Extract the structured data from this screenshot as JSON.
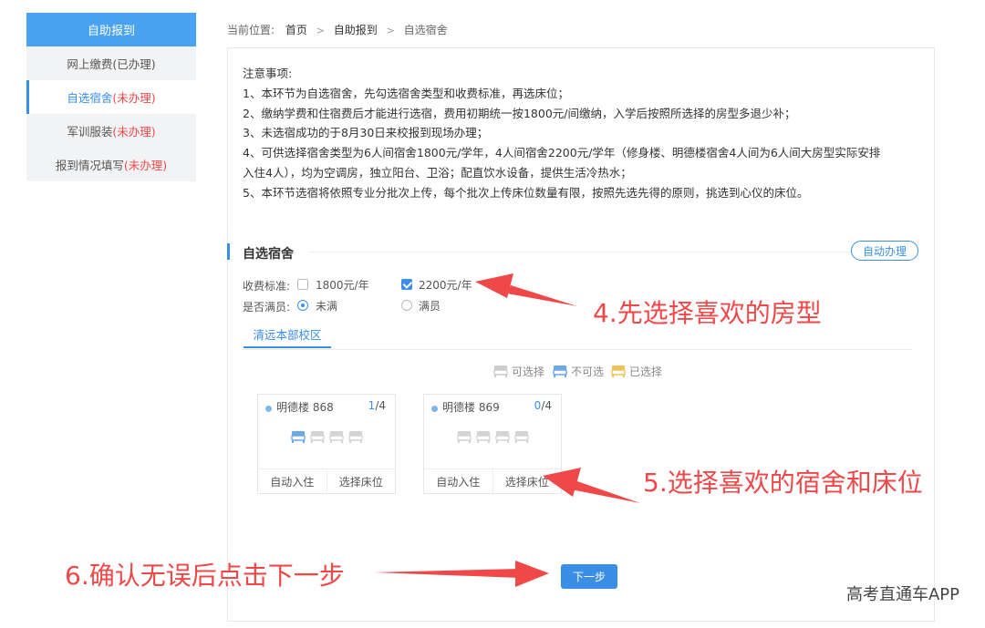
{
  "sidebar": {
    "header": "自助报到",
    "items": [
      {
        "label": "网上缴费",
        "status": "(已办理)"
      },
      {
        "label": "自选宿舍",
        "status": "(未办理)"
      },
      {
        "label": "军训服装",
        "status": "(未办理)"
      },
      {
        "label": "报到情况填写",
        "status": "(未办理)"
      }
    ]
  },
  "breadcrumb": {
    "prefix": "当前位置:",
    "items": [
      "首页",
      "自助报到",
      "自选宿舍"
    ],
    "separator": ">"
  },
  "notice": {
    "title": "注意事项:",
    "lines": [
      "1、本环节为自选宿舍，先勾选宿舍类型和收费标准，再选床位；",
      "2、缴纳学费和住宿费后才能进行选宿，费用初期统一按1800元/间缴纳，入学后按照所选择的房型多退少补；",
      "3、未选宿成功的于8月30日来校报到现场办理；",
      "4、可供选择宿舍类型为6人间宿舍1800元/学年，4人间宿舍2200元/学年（修身楼、明德楼宿舍4人间为6人间大房型实际安排",
      "入住4人），均为空调房，独立阳台、卫浴；配直饮水设备，提供生活冷热水；",
      "5、本环节选宿将依照专业分批次上传，每个批次上传床位数量有限，按照先选先得的原则，挑选到心仪的床位。"
    ]
  },
  "section": {
    "title": "自选宿舍",
    "auto_button": "自动办理"
  },
  "filters": {
    "fee_label": "收费标准:",
    "fee_options": [
      {
        "label": "1800元/年",
        "checked": false
      },
      {
        "label": "2200元/年",
        "checked": true
      }
    ],
    "full_label": "是否满员:",
    "full_options": [
      {
        "label": "未满",
        "checked": true
      },
      {
        "label": "满员",
        "checked": false
      }
    ]
  },
  "campus_tab": "清远本部校区",
  "legend": [
    {
      "label": "可选择",
      "color": "#cccccc"
    },
    {
      "label": "不可选",
      "color": "#6aa8ea"
    },
    {
      "label": "已选择",
      "color": "#f0c35a"
    }
  ],
  "rooms": [
    {
      "name": "明德楼 868",
      "occupied": "1",
      "total": "/4",
      "actions": [
        "自动入住",
        "选择床位"
      ]
    },
    {
      "name": "明德楼 869",
      "occupied": "0",
      "total": "/4",
      "actions": [
        "自动入住",
        "选择床位"
      ]
    }
  ],
  "next_button": "下一步",
  "annotations": {
    "step4": "4.先选择喜欢的房型",
    "step5": "5.选择喜欢的宿舍和床位",
    "step6": "6.确认无误后点击下一步",
    "color": "#f04848"
  },
  "watermark": "高考直通车APP"
}
